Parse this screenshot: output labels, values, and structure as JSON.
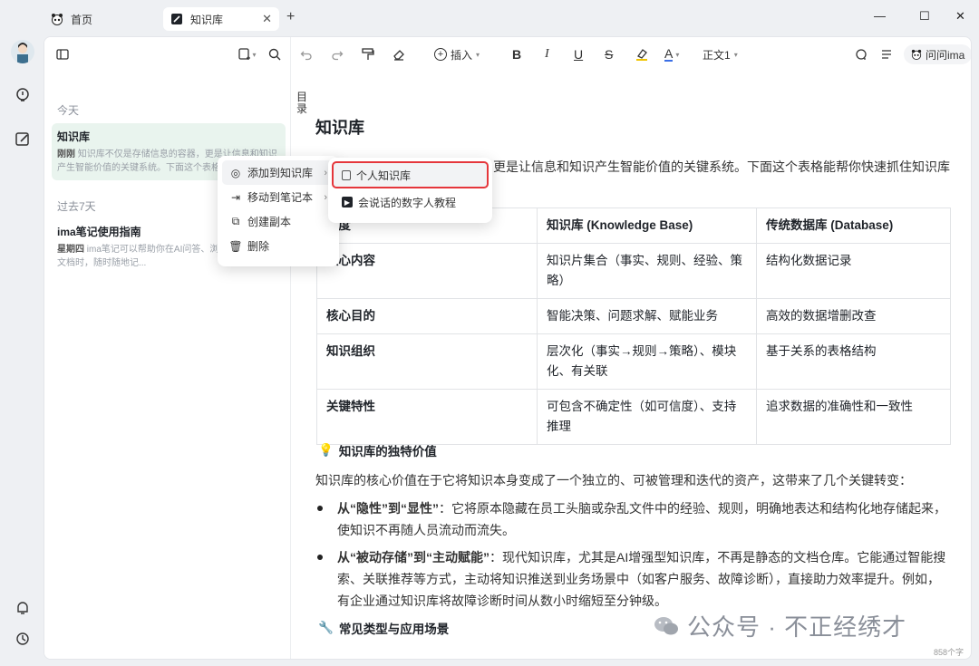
{
  "tabs": [
    {
      "label": "首页",
      "icon": "panda-icon"
    },
    {
      "label": "知识库",
      "icon": "knowledge-icon"
    }
  ],
  "toolbar": {
    "insert_label": "插入",
    "text_style": "正文1",
    "ask_label": "问问ima"
  },
  "sidebar": {
    "today_label": "今天",
    "past_label": "过去7天",
    "notes": [
      {
        "title": "知识库",
        "time": "刚刚",
        "desc": "知识库不仅是存储信息的容器，更是让信息和知识产生智能价值的关键系统。下面这个表格能帮你快速抓住知识库的"
      },
      {
        "title": "ima笔记使用指南",
        "time": "星期四",
        "desc": "ima笔记可以帮助你在AI问答、浏览网页、阅读文档时，随时随地记..."
      }
    ]
  },
  "context_menu": {
    "items": [
      {
        "label": "添加到知识库",
        "icon": "knowledge-add-icon",
        "has_sub": true
      },
      {
        "label": "移动到笔记本",
        "icon": "move-icon",
        "has_sub": true
      },
      {
        "label": "创建副本",
        "icon": "copy-icon",
        "has_sub": false
      },
      {
        "label": "删除",
        "icon": "trash-icon",
        "has_sub": false
      }
    ]
  },
  "submenu": {
    "items": [
      {
        "label": "个人知识库"
      },
      {
        "label": "会说话的数字人教程"
      }
    ]
  },
  "doc": {
    "toc_label": "目录",
    "title": "知识库",
    "intro": "知识库不仅是存储信息的容器，更是让信息和知识产生智能价值的关键系统。下面这个表格能帮你快速抓住知识库的",
    "table": {
      "headers": [
        "维度",
        "知识库 (Knowledge Base)",
        "传统数据库 (Database)"
      ],
      "rows": [
        [
          "核心内容",
          "知识片集合（事实、规则、经验、策略）",
          "结构化数据记录"
        ],
        [
          "核心目的",
          "智能决策、问题求解、赋能业务",
          "高效的数据增删改查"
        ],
        [
          "知识组织",
          "层次化（事实→规则→策略）、模块化、有关联",
          "基于关系的表格结构"
        ],
        [
          "关键特性",
          "可包含不确定性（如可信度）、支持推理",
          "追求数据的准确性和一致性"
        ]
      ]
    },
    "section1_title": "知识库的独特价值",
    "section1_para": "知识库的核心价值在于它将知识本身变成了一个独立的、可被管理和迭代的资产，这带来了几个关键转变：",
    "bullets": [
      {
        "bold": "从“隐性”到“显性”",
        "text": "：它将原本隐藏在员工头脑或杂乱文件中的经验、规则，明确地表达和结构化地存储起来，使知识不再随人员流动而流失。"
      },
      {
        "bold": "从“被动存储”到“主动赋能”",
        "text": "：现代知识库，尤其是AI增强型知识库，不再是静态的文档仓库。它能通过智能搜索、关联推荐等方式，主动将知识推送到业务场景中（如客户服务、故障诊断），直接助力效率提升。例如，有企业通过知识库将故障诊断时间从数小时缩短至分钟级。"
      }
    ],
    "section2_title": "常见类型与应用场景"
  },
  "watermark": "公众号 · 不正经绣才",
  "word_count": "858个字"
}
